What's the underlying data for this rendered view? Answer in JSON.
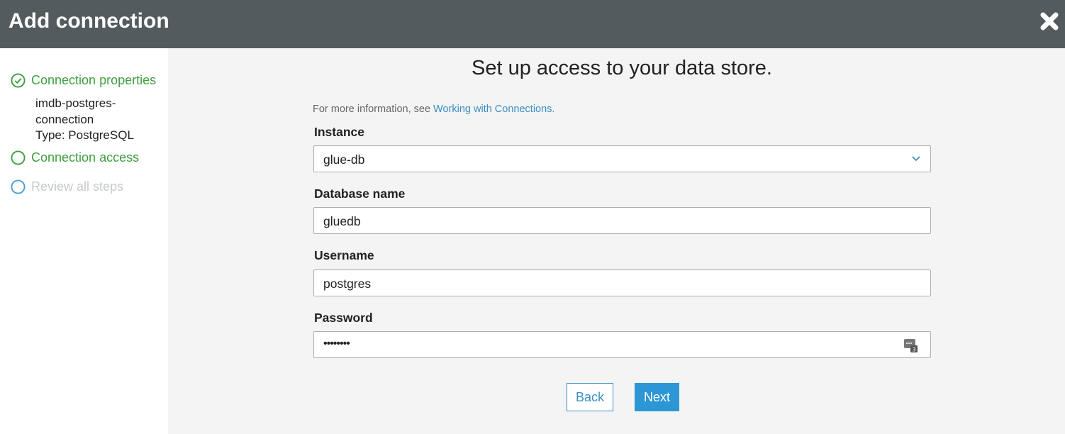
{
  "header": {
    "title": "Add connection",
    "close_icon": "close-icon"
  },
  "sidebar": {
    "steps": [
      {
        "label": "Connection properties",
        "state": "done",
        "icon": "check-circle-icon",
        "details": [
          "imdb-postgres-",
          "connection",
          "Type: PostgreSQL"
        ]
      },
      {
        "label": "Connection access",
        "state": "active",
        "icon": "circle-icon"
      },
      {
        "label": "Review all steps",
        "state": "pending",
        "icon": "circle-icon"
      }
    ]
  },
  "main": {
    "title": "Set up access to your data store.",
    "info_prefix": "For more information, see ",
    "info_link": "Working with Connections.",
    "fields": {
      "instance": {
        "label": "Instance",
        "value": "glue-db"
      },
      "database": {
        "label": "Database name",
        "value": "gluedb"
      },
      "username": {
        "label": "Username",
        "value": "postgres"
      },
      "password": {
        "label": "Password",
        "value": "••••••••"
      }
    },
    "buttons": {
      "back": "Back",
      "next": "Next"
    }
  },
  "colors": {
    "header_bg": "#545b5e",
    "success": "#3e9f3e",
    "link": "#3b8fc4",
    "primary": "#2d96d4"
  }
}
